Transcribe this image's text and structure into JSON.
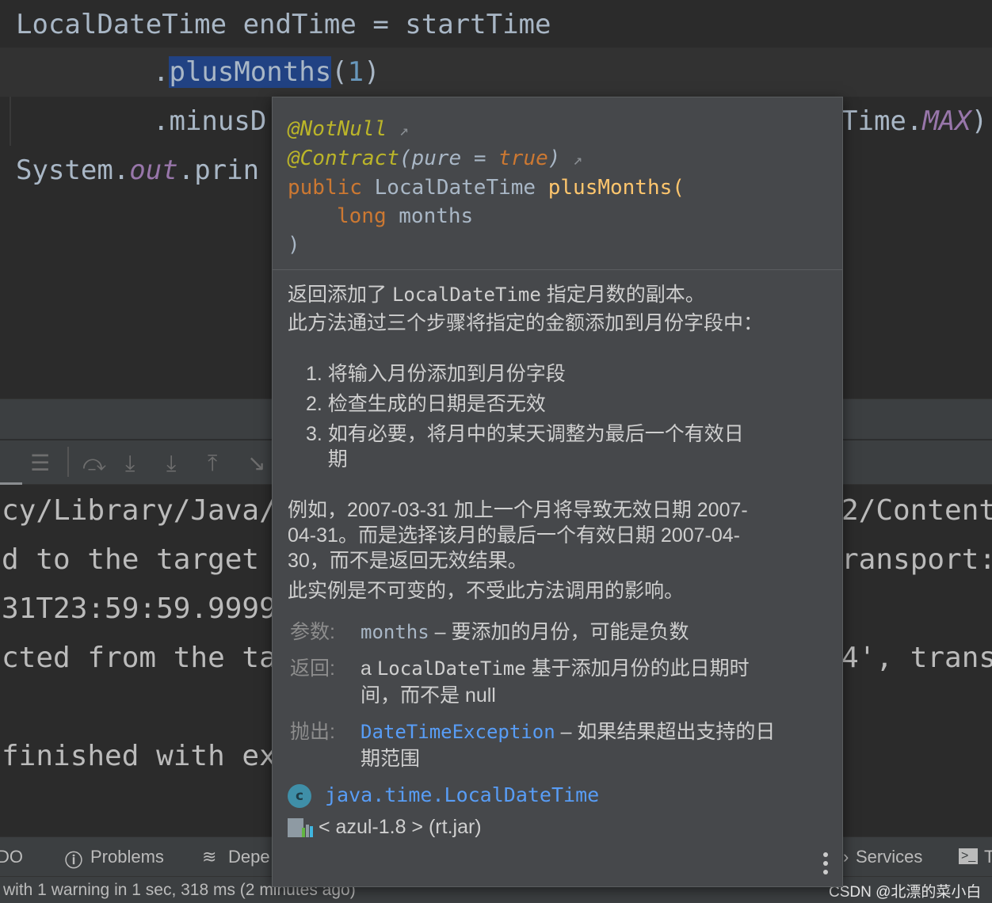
{
  "editor": {
    "line1": "LocalDateTime endTime = startTime",
    "line2_dot": ".",
    "line2_method": "plusMonths",
    "line2_open": "(",
    "line2_arg": "1",
    "line2_close": ")",
    "line3_left": ".minusD",
    "line3_right_a": "Time.",
    "line3_right_b": "MAX",
    "line3_right_c": ")",
    "line4_a": "System.",
    "line4_b": "out",
    "line4_c": ".prin"
  },
  "console": {
    "lines_left": [
      "cy/Library/Java/",
      "d to the target",
      "31T23:59:59.9999",
      "cted from the ta",
      "finished with ex"
    ],
    "lines_right": [
      "2/Content",
      "ransport:",
      "",
      "4', trans",
      ""
    ]
  },
  "bottom_bar": {
    "todo": "DO",
    "problems": "Problems",
    "dependencies": "Depe",
    "services": "Services",
    "terminal": "T"
  },
  "status": {
    "text": "with 1 warning in 1 sec, 318 ms (2 minutes ago)",
    "watermark": "CSDN @北漂的菜小白"
  },
  "popup": {
    "sig": {
      "ann1": "@NotNull",
      "ann2": "@Contract",
      "ann2_open": "(",
      "ann2_param": "pure",
      "ann2_eq": " = ",
      "ann2_val": "true",
      "ann2_close": ")",
      "kw_public": "public",
      "ret_type": " LocalDateTime ",
      "method": "plusMonths",
      "open": "(",
      "kw_long": "long",
      "param": " months",
      "close": ")"
    },
    "desc1a": "返回添加了 ",
    "desc1b": "LocalDateTime",
    "desc1c": " 指定月数的副本。",
    "desc2": "此方法通过三个步骤将指定的金额添加到月份字段中：",
    "steps": [
      "1. 将输入月份添加到月份字段",
      "2. 检查生成的日期是否无效",
      "3. 如有必要，将月中的某天调整为最后一个有效日",
      "    期"
    ],
    "example1": "例如，2007-03-31 加上一个月将导致无效日期 2007-",
    "example2": "04-31。而是选择该月的最后一个有效日期 2007-04-",
    "example3": "30，而不是返回无效结果。",
    "immutable": "此实例是不可变的，不受此方法调用的影响。",
    "params_label": "参数:",
    "params_name": "months",
    "params_desc": " – 要添加的月份，可能是负数",
    "returns_label": "返回:",
    "returns_a": "a ",
    "returns_type": "LocalDateTime",
    "returns_desc1": " 基于添加月份的此日期时",
    "returns_desc2": "间，而不是 null",
    "throws_label": "抛出:",
    "throws_link": "DateTimeException",
    "throws_desc1": " – 如果结果超出支持的日",
    "throws_desc2": "期范围",
    "class_badge": "c",
    "class_name": "java.time.LocalDateTime",
    "library": "< azul-1.8 > (rt.jar)"
  },
  "colors": {
    "selection": "#214283",
    "annotation": "#bbb529",
    "keyword": "#cc7832",
    "method": "#ffc66d",
    "link": "#589df6"
  }
}
